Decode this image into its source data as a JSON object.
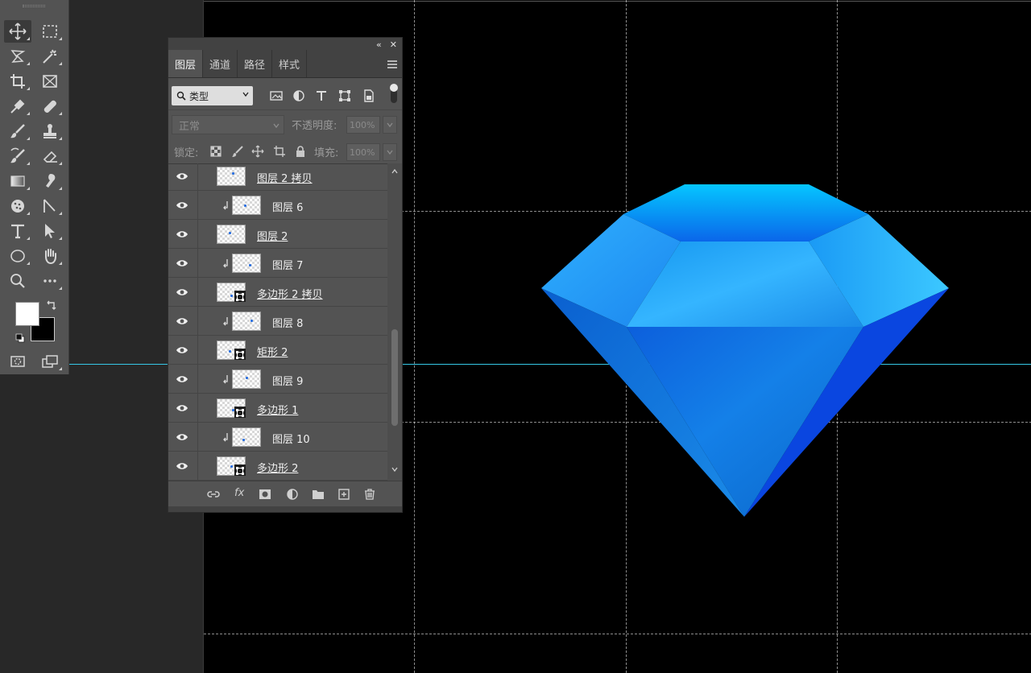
{
  "app": {
    "name": "Photoshop"
  },
  "panel": {
    "tabs": [
      {
        "label": "图层",
        "active": true
      },
      {
        "label": "通道",
        "active": false
      },
      {
        "label": "路径",
        "active": false
      },
      {
        "label": "样式",
        "active": false
      }
    ],
    "filter": {
      "label": "类型"
    },
    "blend_mode": "正常",
    "opacity": {
      "label": "不透明度:",
      "value": "100%"
    },
    "lock": {
      "label": "锁定:"
    },
    "fill": {
      "label": "填充:",
      "value": "100%"
    },
    "layers": [
      {
        "name": "图层 2 拷贝",
        "clipped": false,
        "linked": true,
        "shape": false
      },
      {
        "name": "图层 6",
        "clipped": true,
        "linked": false,
        "shape": false
      },
      {
        "name": "图层 2",
        "clipped": false,
        "linked": true,
        "shape": false
      },
      {
        "name": "图层 7",
        "clipped": true,
        "linked": false,
        "shape": false
      },
      {
        "name": "多边形 2 拷贝",
        "clipped": false,
        "linked": true,
        "shape": true
      },
      {
        "name": "图层 8",
        "clipped": true,
        "linked": false,
        "shape": false
      },
      {
        "name": "矩形 2",
        "clipped": false,
        "linked": true,
        "shape": true
      },
      {
        "name": "图层 9",
        "clipped": true,
        "linked": false,
        "shape": false
      },
      {
        "name": "多边形 1",
        "clipped": false,
        "linked": true,
        "shape": true
      },
      {
        "name": "图层 10",
        "clipped": true,
        "linked": false,
        "shape": false
      },
      {
        "name": "多边形 2",
        "clipped": false,
        "linked": true,
        "shape": true
      }
    ],
    "footer": {
      "fx_label": "fx"
    }
  },
  "colors": {
    "foreground": "#ffffff",
    "background": "#000000",
    "guide": "#35c8e6",
    "diamond_light": "#3fc6ff",
    "diamond_mid": "#1a8cf0",
    "diamond_dark": "#0a3fd8"
  }
}
